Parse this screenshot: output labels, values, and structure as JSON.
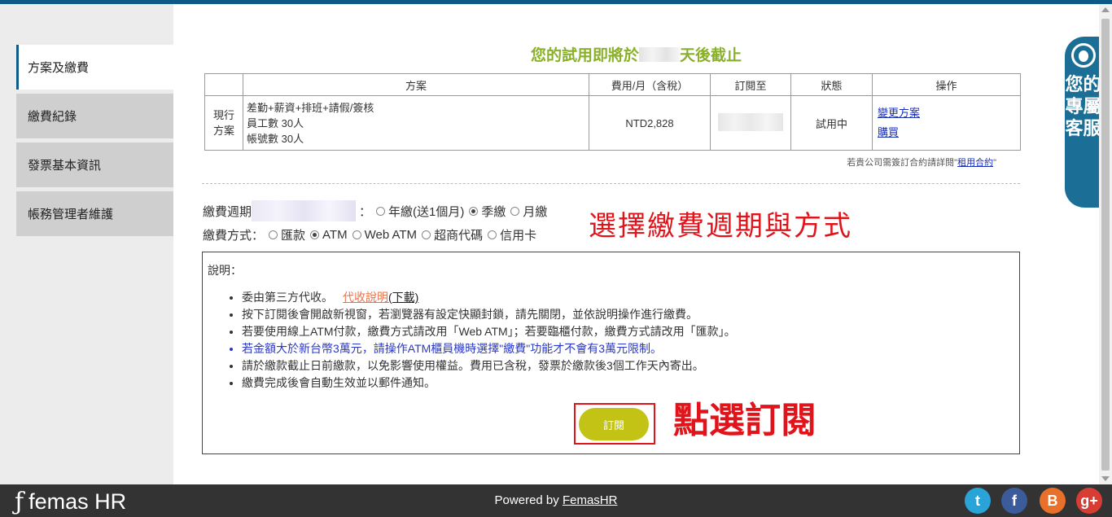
{
  "sidebar": {
    "items": [
      {
        "label": "方案及繳費"
      },
      {
        "label": "繳費紀錄"
      },
      {
        "label": "發票基本資訊"
      },
      {
        "label": "帳務管理者維護"
      }
    ]
  },
  "trial": {
    "prefix": "您的試用即將於",
    "suffix": "天後截止"
  },
  "table": {
    "headers": [
      "方案",
      "費用/月（含稅）",
      "訂閱至",
      "狀態",
      "操作"
    ],
    "row": {
      "label": "現行方案",
      "plan_lines": [
        "差勤+薪資+排班+請假/簽核",
        "員工數 30人",
        "帳號數 30人"
      ],
      "fee": "NTD2,828",
      "status": "試用中",
      "actions": [
        "變更方案",
        "購買"
      ]
    }
  },
  "contract_note": {
    "prefix": "若貴公司需簽訂合約請詳閱\"",
    "link": "租用合約",
    "suffix": "\""
  },
  "cycle": {
    "label": "繳費週期",
    "colon": "：",
    "options": [
      "年繳(送1個月)",
      "季繳",
      "月繳"
    ],
    "selected": "季繳"
  },
  "method": {
    "label": "繳費方式：",
    "options": [
      "匯款",
      "ATM",
      "Web ATM",
      "超商代碼",
      "信用卡"
    ],
    "selected": "ATM"
  },
  "annotation_select": "選擇繳費週期與方式",
  "info": {
    "label": "說明：",
    "items": [
      {
        "text": "委由第三方代收。",
        "link": "代收說明",
        "link2": "(下載)"
      },
      {
        "text": "按下訂閱後會開啟新視窗，若瀏覽器有設定快顯封鎖，請先關閉，並依說明操作進行繳費。"
      },
      {
        "text": "若要使用線上ATM付款，繳費方式請改用「Web ATM」；若要臨櫃付款，繳費方式請改用「匯款」。"
      },
      {
        "text": "若金額大於新台幣3萬元，請操作ATM櫃員機時選擇\"繳費\"功能才不會有3萬元限制。",
        "blue": true
      },
      {
        "text": "請於繳款截止日前繳款，以免影響使用權益。費用已含稅，發票於繳款後3個工作天內寄出。"
      },
      {
        "text": "繳費完成後會自動生效並以郵件通知。"
      }
    ],
    "subscribe": "訂閱",
    "annotation_click": "點選訂閱"
  },
  "service_text": "您的專屬客服",
  "footer": {
    "brand": "femas HR",
    "powered_prefix": "Powered by ",
    "powered_link": "FemasHR"
  },
  "social": [
    {
      "name": "twitter",
      "glyph": "t",
      "color": "#2aa3d8"
    },
    {
      "name": "facebook",
      "glyph": "f",
      "color": "#3b5b9a"
    },
    {
      "name": "blogger",
      "glyph": "B",
      "color": "#e8702a"
    },
    {
      "name": "google-plus",
      "glyph": "g+",
      "color": "#d73d32"
    }
  ]
}
